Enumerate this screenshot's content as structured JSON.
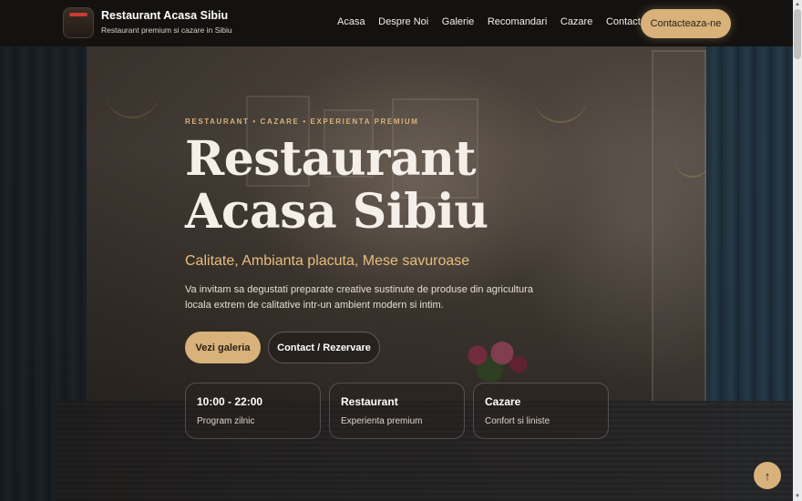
{
  "header": {
    "brand_name": "Restaurant Acasa Sibiu",
    "brand_tagline": "Restaurant premium si cazare in Sibiu",
    "nav": [
      "Acasa",
      "Despre Noi",
      "Galerie",
      "Recomandari",
      "Cazare",
      "Contact"
    ],
    "cta_label": "Contacteaza-ne"
  },
  "hero": {
    "eyebrow": "RESTAURANT • CAZARE • EXPERIENTA PREMIUM",
    "title": "Restaurant Acasa Sibiu",
    "tagline": "Calitate, Ambianta placuta, Mese savuroase",
    "description": "Va invitam sa degustati preparate creative sustinute de produse din agricultura locala extrem de calitative intr-un ambient modern si intim.",
    "primary_button": "Vezi galeria",
    "secondary_button": "Contact / Rezervare"
  },
  "cards": [
    {
      "title": "10:00 - 22:00",
      "subtitle": "Program zilnic"
    },
    {
      "title": "Restaurant",
      "subtitle": "Experienta premium"
    },
    {
      "title": "Cazare",
      "subtitle": "Confort si liniste"
    }
  ],
  "icons": {
    "back_to_top": "arrow-up-icon",
    "logo": "restaurant-logo"
  },
  "colors": {
    "accent": "#d8b27a",
    "header_bg": "#141210",
    "tagline": "#e8bd7d"
  }
}
